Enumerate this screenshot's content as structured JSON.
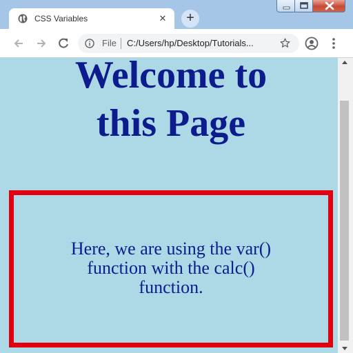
{
  "browser": {
    "tab": {
      "title": "CSS Variables",
      "favicon": "globe-icon",
      "close_glyph": "✕"
    },
    "new_tab_glyph": "+",
    "address": {
      "scheme": "File",
      "url": "C:/Users/hp/Desktop/Tutorials..."
    },
    "icons": [
      "back-icon",
      "forward-icon",
      "reload-icon",
      "info-icon",
      "star-icon",
      "profile-icon",
      "menu-icon"
    ]
  },
  "page": {
    "heading_line1": "Welcome to",
    "heading_line2": "this Page",
    "box_line1": "Here, we are using the var()",
    "box_line2": "function with the calc()",
    "box_line3": "function."
  },
  "colors": {
    "page_background": "#add8e6",
    "text": "#0c1c8c",
    "box_border": "#e0000f",
    "window_frame": "#a6c6e8"
  }
}
